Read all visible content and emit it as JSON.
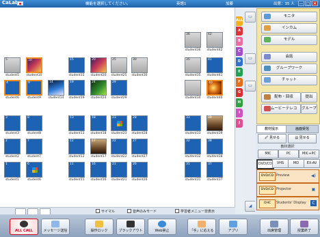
{
  "titlebar": {
    "app_name": "CaLabo",
    "message": "機能を選択してください。",
    "status1": "英語1",
    "status2": "加藤",
    "present_label": "出席：35 人",
    "window_buttons": [
      "—",
      "□",
      "✕"
    ]
  },
  "seats": [
    {
      "num": "36",
      "name": "student36",
      "bg": "gray",
      "col": 9,
      "row": 0
    },
    {
      "num": "42",
      "name": "student42",
      "bg": "gray",
      "col": 10,
      "row": 0
    },
    {
      "num": "5",
      "name": "student5",
      "bg": "gray",
      "col": 0,
      "row": 1
    },
    {
      "num": "10",
      "name": "student10",
      "bg": "pic1",
      "col": 1,
      "row": 1,
      "sel": true
    },
    {
      "num": "15",
      "name": "student15",
      "bg": "blue",
      "col": 3,
      "row": 1
    },
    {
      "num": "20",
      "name": "student20",
      "bg": "pic1",
      "col": 4,
      "row": 1
    },
    {
      "num": "25",
      "name": "student25",
      "bg": "gray",
      "col": 5,
      "row": 1
    },
    {
      "num": "30",
      "name": "student30",
      "bg": "gray",
      "col": 6,
      "row": 1
    },
    {
      "num": "35",
      "name": "student35",
      "bg": "gray",
      "col": 9,
      "row": 1
    },
    {
      "num": "41",
      "name": "student41",
      "bg": "blue",
      "col": 10,
      "row": 1
    },
    {
      "num": "4",
      "name": "student6",
      "bg": "blue",
      "col": 0,
      "row": 2,
      "sel": true
    },
    {
      "num": "9",
      "name": "student9",
      "bg": "blue",
      "col": 1,
      "row": 2,
      "sel": true
    },
    {
      "num": "14",
      "name": "student14",
      "bg": "pic2",
      "col": 2,
      "row": 2
    },
    {
      "num": "19",
      "name": "student19",
      "bg": "blue",
      "col": 3,
      "row": 2
    },
    {
      "num": "24",
      "name": "student24",
      "bg": "pic3",
      "col": 4,
      "row": 2
    },
    {
      "num": "29",
      "name": "student29",
      "bg": "blue",
      "col": 5,
      "row": 2
    },
    {
      "num": "",
      "name": "student34",
      "bg": "gray",
      "col": 9,
      "row": 2
    },
    {
      "num": "40",
      "name": "student40",
      "bg": "pic4",
      "col": 10,
      "row": 2,
      "sel": true
    },
    {
      "num": "3",
      "name": "student3",
      "bg": "blue",
      "col": 0,
      "row": 3
    },
    {
      "num": "8",
      "name": "student8",
      "bg": "blue",
      "col": 1,
      "row": 3
    },
    {
      "num": "13",
      "name": "student13",
      "bg": "blue",
      "col": 3,
      "row": 3
    },
    {
      "num": "18",
      "name": "student18",
      "bg": "blue",
      "col": 4,
      "row": 3
    },
    {
      "num": "23",
      "name": "student23",
      "bg": "logo",
      "col": 5,
      "row": 3
    },
    {
      "num": "28",
      "name": "student28",
      "bg": "blue",
      "col": 6,
      "row": 3
    },
    {
      "num": "33",
      "name": "student33",
      "bg": "blue",
      "col": 9,
      "row": 3
    },
    {
      "num": "39",
      "name": "student39",
      "bg": "pic5",
      "col": 10,
      "row": 3
    },
    {
      "num": "2",
      "name": "student2",
      "bg": "blue",
      "col": 0,
      "row": 4
    },
    {
      "num": "7",
      "name": "student7",
      "bg": "blue",
      "col": 1,
      "row": 4
    },
    {
      "num": "12",
      "name": "student12",
      "bg": "blue",
      "col": 3,
      "row": 4
    },
    {
      "num": "17",
      "name": "student17",
      "bg": "pic5",
      "col": 4,
      "row": 4
    },
    {
      "num": "22",
      "name": "student22",
      "bg": "blue",
      "col": 5,
      "row": 4
    },
    {
      "num": "27",
      "name": "student27",
      "bg": "blue",
      "col": 6,
      "row": 4
    },
    {
      "num": "32",
      "name": "student32",
      "bg": "blue",
      "col": 9,
      "row": 4
    },
    {
      "num": "38",
      "name": "student38",
      "bg": "blue",
      "col": 10,
      "row": 4
    },
    {
      "num": "1",
      "name": "student1",
      "bg": "blue",
      "col": 0,
      "row": 5
    },
    {
      "num": "6",
      "name": "student6",
      "bg": "logo",
      "col": 1,
      "row": 5
    },
    {
      "num": "11",
      "name": "student11",
      "bg": "blue",
      "col": 3,
      "row": 5
    },
    {
      "num": "16",
      "name": "student16",
      "bg": "blue",
      "col": 4,
      "row": 5
    },
    {
      "num": "21",
      "name": "student21",
      "bg": "blue",
      "col": 5,
      "row": 5
    },
    {
      "num": "26",
      "name": "student26",
      "bg": "blue",
      "col": 6,
      "row": 5
    },
    {
      "num": "31",
      "name": "student31",
      "bg": "blue",
      "col": 9,
      "row": 5
    },
    {
      "num": "37",
      "name": "student37",
      "bg": "blue",
      "col": 10,
      "row": 5
    }
  ],
  "group_tabs": [
    {
      "label": "ALL",
      "color": "#f2b11a"
    },
    {
      "label": "A",
      "color": "#e0303a"
    },
    {
      "label": "B",
      "color": "#ef6aa0"
    },
    {
      "label": "C",
      "color": "#a050c8"
    },
    {
      "label": "D",
      "color": "#3070d0"
    },
    {
      "label": "E",
      "color": "#20a050"
    },
    {
      "label": "F",
      "color": "#e07020"
    },
    {
      "label": "G",
      "color": "#d83030"
    },
    {
      "label": "H",
      "color": "#30a040"
    },
    {
      "label": "I",
      "color": "#d050c0"
    },
    {
      "label": "J",
      "color": "#e05090"
    }
  ],
  "functions": {
    "monitor": "モニタ",
    "intercom": "インカム",
    "model": "モデル",
    "conversation": "会話",
    "groupwork": "グループワーク",
    "chat": "チャット",
    "distribute": "配布・回収",
    "submit": "提出",
    "movie": "ムービーテレコ",
    "group": "グループ"
  },
  "materials": {
    "tab_active": "教材提示",
    "tab_other": "画面受信",
    "show_label": "見せる",
    "show2_label": "見せる",
    "select_header": "教材選択",
    "sources_row1": [
      "MIC",
      "PC",
      "MIC+PC"
    ],
    "sources_row2": [
      "DVD/CD",
      "VHS",
      "MD",
      "EX-AV"
    ],
    "route_src": "DVD/CD",
    "route1": "Preview",
    "route2": "Projector",
    "route3_src": "OHC",
    "route3": "Students' Display"
  },
  "statusbar": {
    "check1": "サイマル",
    "check2": "音声のみモード",
    "check3": "学習者メニュー非表示"
  },
  "toolbar": {
    "all_call": "ALL CALL",
    "message": "メッセージ送信",
    "lock": "操作ロック",
    "blackout": "ブラックアウト",
    "web": "Web禁止",
    "hand": "「手」に応える",
    "app": "アプリ",
    "attendance": "出席管理",
    "end": "授業終了"
  },
  "colors": {
    "accent": "#1f62a8",
    "panel": "#f2e6a8",
    "selected": "#f08a1a",
    "all_call": "#d0021b"
  }
}
